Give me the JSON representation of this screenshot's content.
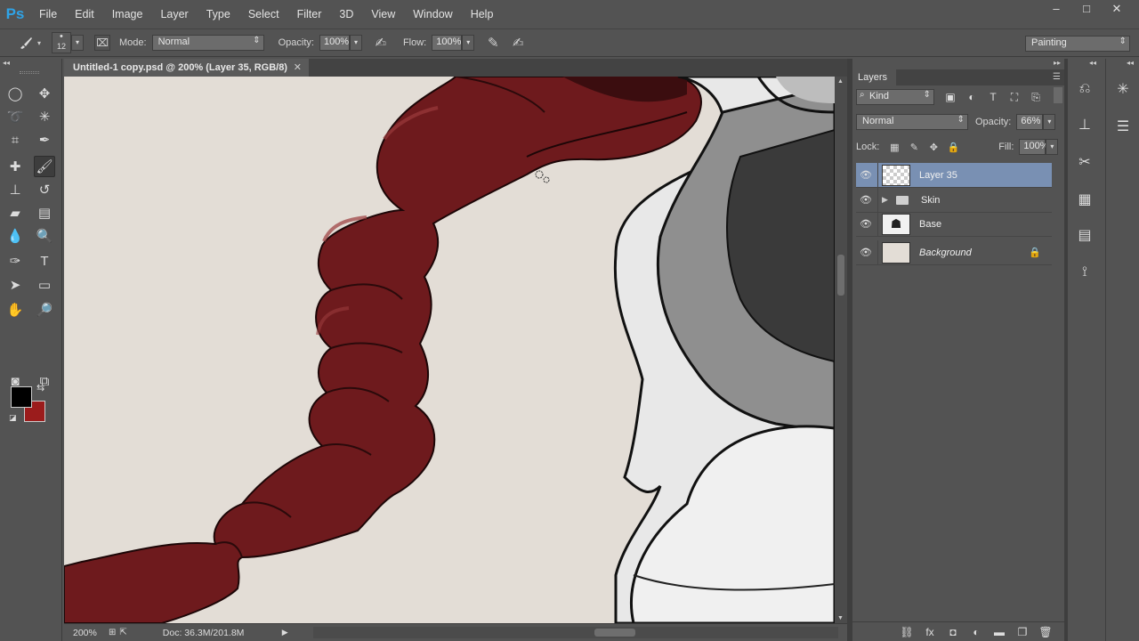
{
  "app": {
    "logo": "Ps"
  },
  "menu": [
    "File",
    "Edit",
    "Image",
    "Layer",
    "Type",
    "Select",
    "Filter",
    "3D",
    "View",
    "Window",
    "Help"
  ],
  "window_controls": {
    "minimize": "–",
    "restore": "□",
    "close": "✕"
  },
  "options": {
    "brush_size": "12",
    "mode_label": "Mode:",
    "mode_value": "Normal",
    "opacity_label": "Opacity:",
    "opacity_value": "100%",
    "flow_label": "Flow:",
    "flow_value": "100%",
    "workspace": "Painting"
  },
  "document": {
    "tab_title": "Untitled-1 copy.psd @ 200% (Layer 35, RGB/8)",
    "close": "✕"
  },
  "status": {
    "zoom": "200%",
    "doc_size": "Doc: 36.3M/201.8M"
  },
  "layers_panel": {
    "title": "Layers",
    "filter_kind": "Kind",
    "blend_mode": "Normal",
    "opacity_label": "Opacity:",
    "opacity_value": "66%",
    "lock_label": "Lock:",
    "fill_label": "Fill:",
    "fill_value": "100%",
    "layers": [
      {
        "name": "Layer 35",
        "selected": true
      },
      {
        "name": "Skin",
        "type": "group"
      },
      {
        "name": "Base"
      },
      {
        "name": "Background",
        "locked": true
      }
    ]
  },
  "colors": {
    "foreground": "#000000",
    "background": "#9b1c1c",
    "selection": "#7990b3",
    "canvas": "#e3ddd6",
    "hair": "#6e1a1d"
  }
}
